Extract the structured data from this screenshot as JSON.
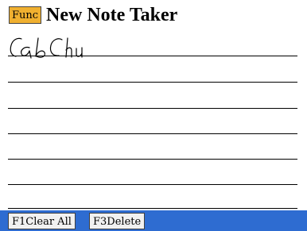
{
  "header": {
    "func_label": "Func",
    "title": "New Note Taker"
  },
  "note": {
    "ink_icon": "handwriting-ink",
    "ink_color": "#000000"
  },
  "softkeys": {
    "clear_all": "F1Clear All",
    "delete": "F3Delete"
  },
  "colors": {
    "func_bg": "#f0b030",
    "softkey_bar": "#2e6cd1",
    "softkey_bg": "#f1f1f1"
  }
}
